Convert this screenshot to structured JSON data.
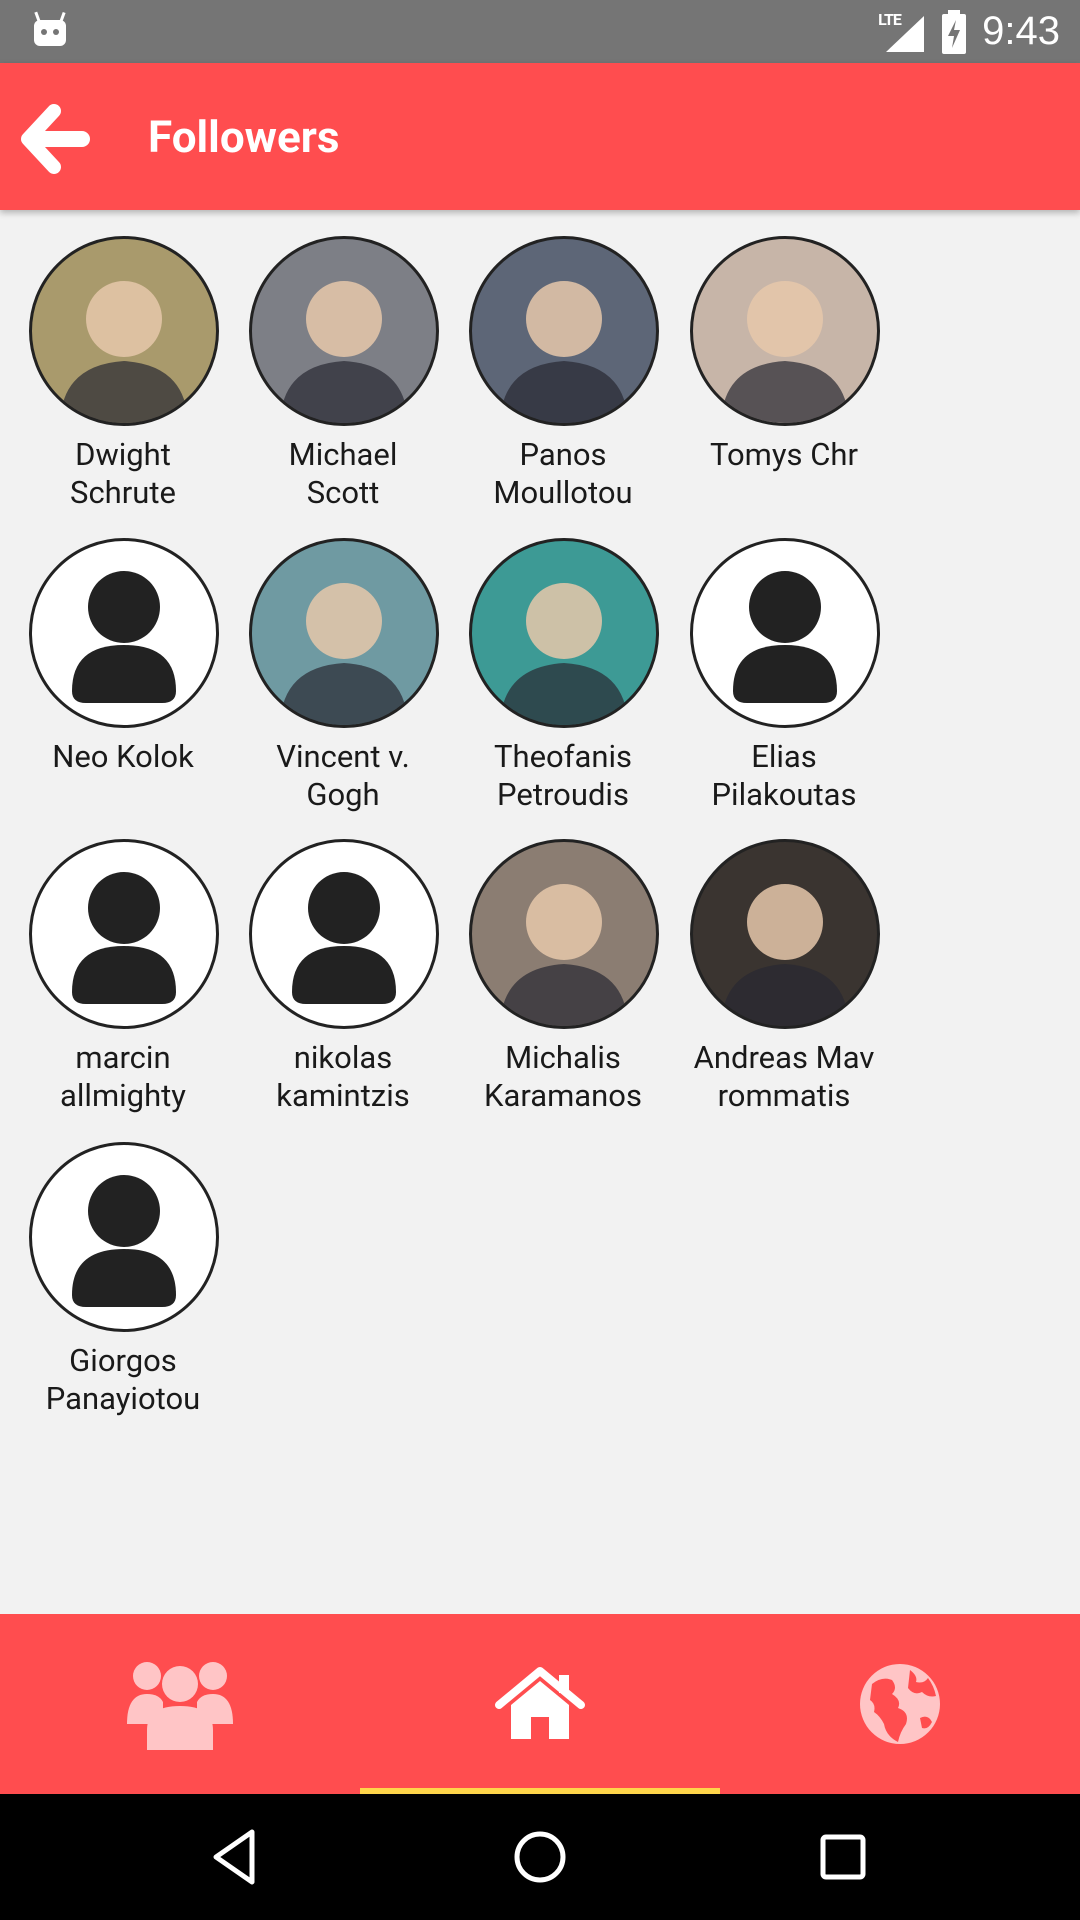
{
  "status_bar": {
    "time": "9:43",
    "network": "LTE"
  },
  "app_bar": {
    "title": "Followers"
  },
  "followers": [
    {
      "name": "Dwight\nSchrute",
      "avatar": "photo",
      "tone": "#a99a6c"
    },
    {
      "name": "Michael\nScott",
      "avatar": "photo",
      "tone": "#7d7f86"
    },
    {
      "name": "Panos\nMoullotou",
      "avatar": "photo",
      "tone": "#5d6677"
    },
    {
      "name": "Tomys Chr",
      "avatar": "photo",
      "tone": "#c7b5a8"
    },
    {
      "name": "Neo Kolok",
      "avatar": "placeholder"
    },
    {
      "name": "Vincent v.\nGogh",
      "avatar": "photo",
      "tone": "#6f9aa2"
    },
    {
      "name": "Theofanis\nPetroudis",
      "avatar": "photo",
      "tone": "#3d9a95"
    },
    {
      "name": "Elias\nPilakoutas",
      "avatar": "placeholder"
    },
    {
      "name": "marcin\nallmighty",
      "avatar": "placeholder"
    },
    {
      "name": "nikolas\nkamintzis",
      "avatar": "placeholder"
    },
    {
      "name": "Michalis\nKaramanos",
      "avatar": "photo",
      "tone": "#8b7d72"
    },
    {
      "name": "Andreas Mav\nrommatis",
      "avatar": "photo",
      "tone": "#3a3430"
    },
    {
      "name": "Giorgos\nPanayiotou",
      "avatar": "placeholder"
    }
  ],
  "bottom_nav": [
    {
      "icon": "group-icon"
    },
    {
      "icon": "home-icon"
    },
    {
      "icon": "globe-icon"
    }
  ],
  "colors": {
    "primary": "#ff4d4f",
    "indicator": "#ffd54a",
    "icon_inactive": "#ffc5c6"
  }
}
